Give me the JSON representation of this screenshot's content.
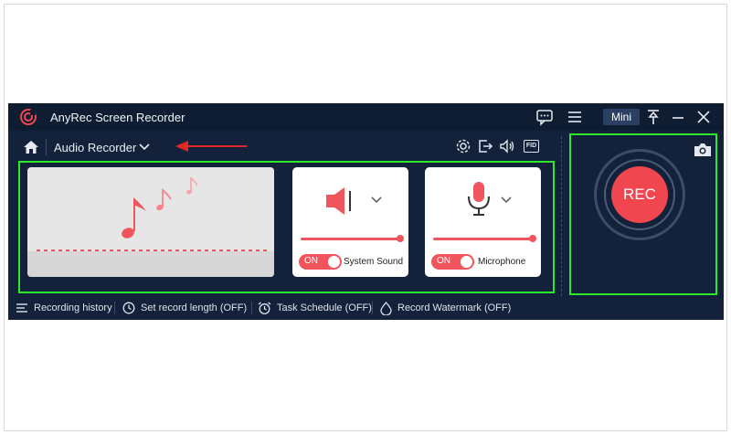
{
  "app": {
    "title": "AnyRec Screen Recorder",
    "mini_label": "Mini",
    "accent": "#f0464f",
    "background": "#13223a"
  },
  "nav": {
    "mode_label": "Audio Recorder"
  },
  "sources": {
    "system_sound": {
      "toggle_label": "ON",
      "label": "System Sound",
      "volume_percent": 100
    },
    "microphone": {
      "toggle_label": "ON",
      "label": "Microphone",
      "volume_percent": 100
    }
  },
  "rec": {
    "label": "REC"
  },
  "bottom_bar": {
    "history": "Recording history",
    "record_length": "Set record length (OFF)",
    "task_schedule": "Task Schedule (OFF)",
    "watermark": "Record Watermark (OFF)"
  },
  "icons": [
    "logo-icon",
    "feedback-icon",
    "menu-icon",
    "pin-icon",
    "minimize-icon",
    "close-icon",
    "home-icon",
    "chevron-down-icon",
    "settings-icon",
    "export-icon",
    "volume-icon",
    "fid-icon",
    "speaker-icon",
    "microphone-icon",
    "camera-icon",
    "list-icon",
    "clock-icon",
    "alarm-icon",
    "water-drop-icon"
  ],
  "colors": {
    "highlight": "#2ee82a",
    "annotation_arrow": "#e32626"
  }
}
